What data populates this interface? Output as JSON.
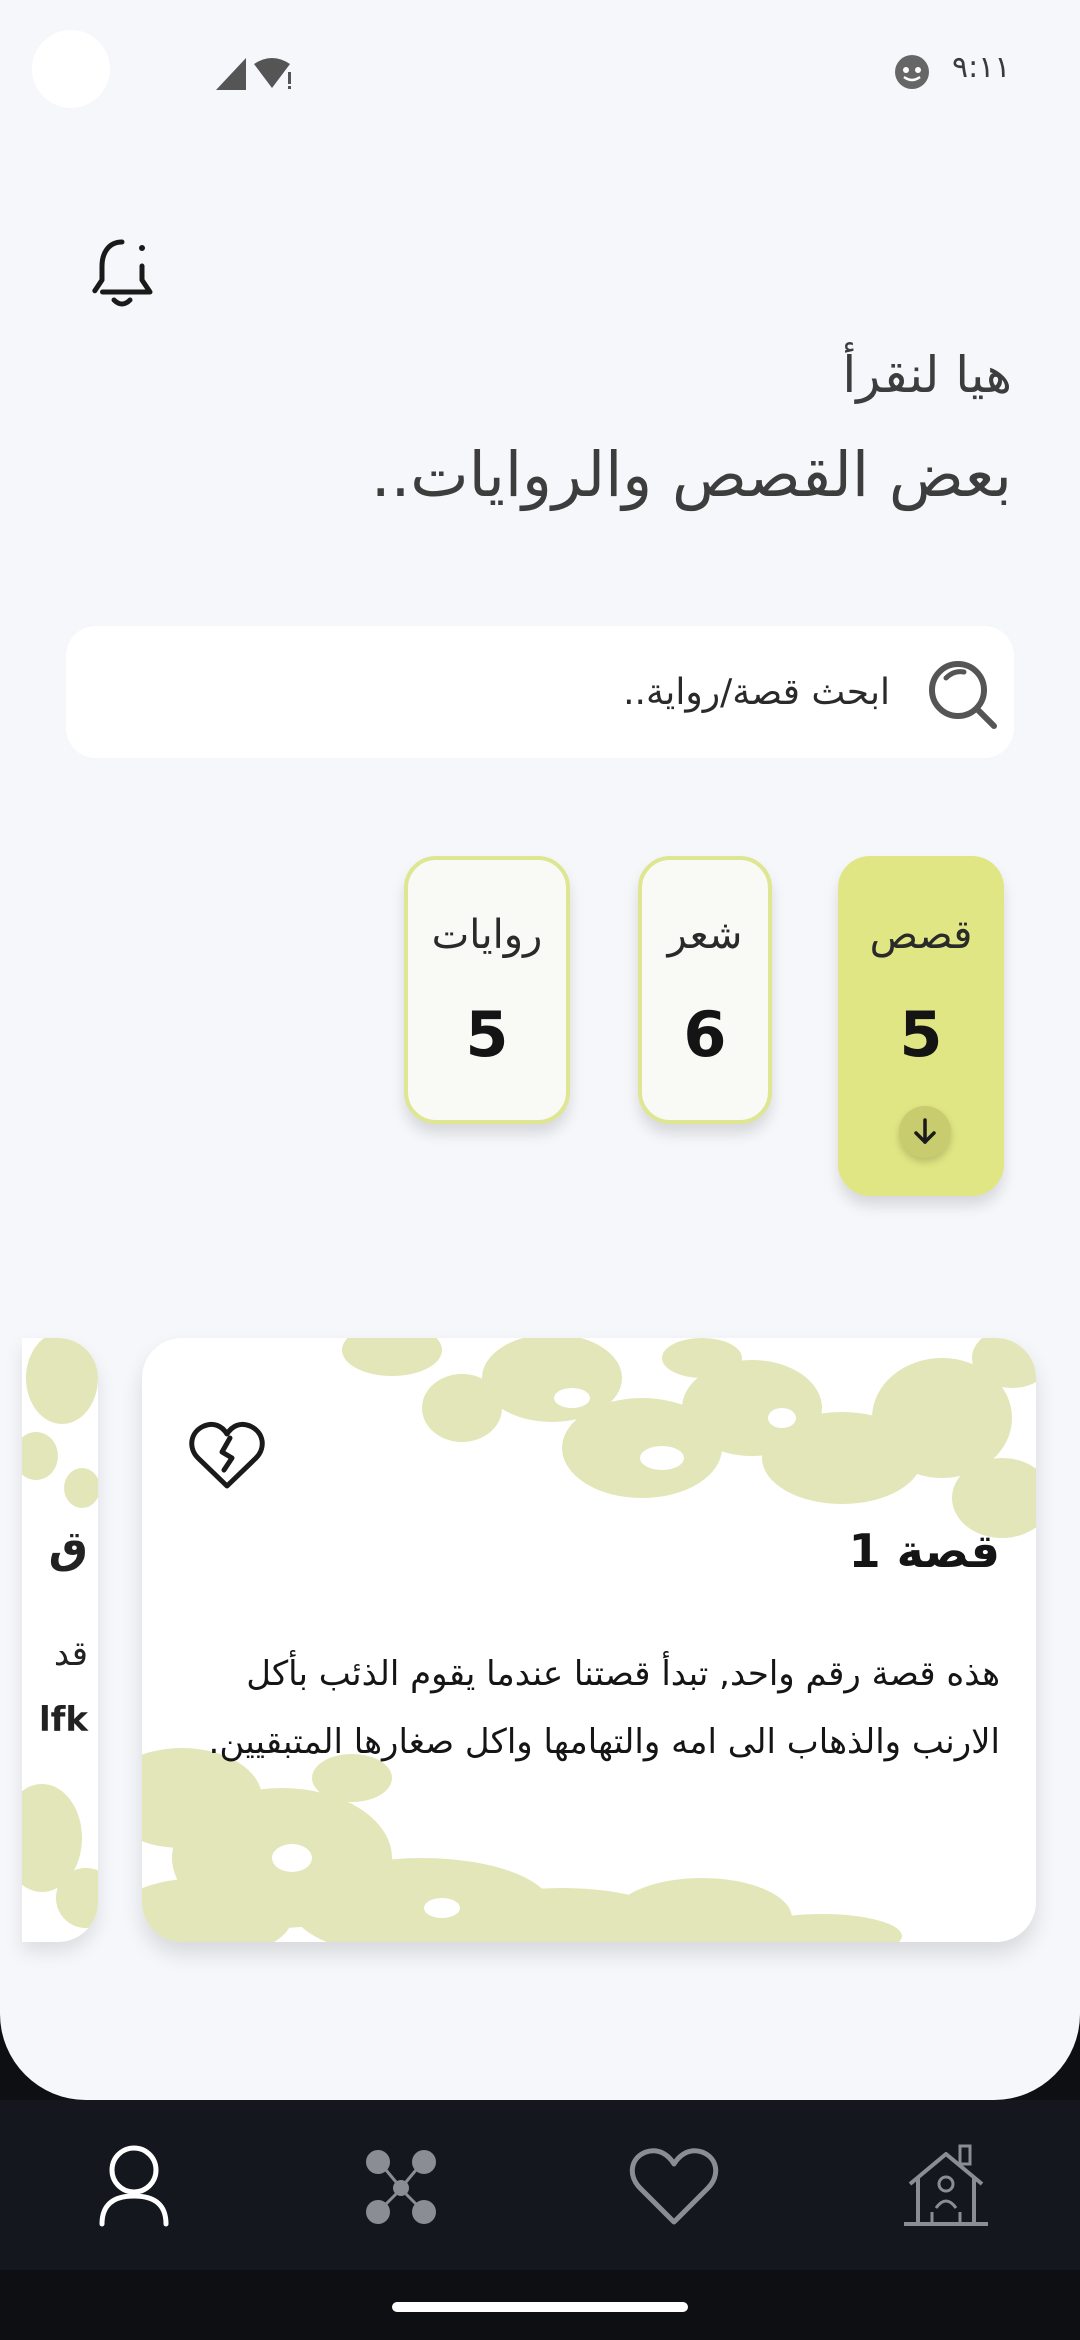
{
  "status_bar": {
    "time": "٩:١١"
  },
  "header": {
    "greeting_line1": "هيا لنقرأ",
    "greeting_line2": "بعض القصص والروايات.."
  },
  "search": {
    "placeholder": "ابحث قصة/رواية.."
  },
  "categories": [
    {
      "label": "قصص",
      "count": "5",
      "active": true
    },
    {
      "label": "شعر",
      "count": "6",
      "active": false
    },
    {
      "label": "روايات",
      "count": "5",
      "active": false
    }
  ],
  "stories": [
    {
      "title": "قصة 1",
      "body": "هذه قصة رقم واحد, تبدأ قصتنا عندما يقوم الذئب بأكل الارنب والذهاب الى امه والتهامها واكل صغارها المتبقيين."
    }
  ],
  "peek_card": {
    "title_fragment": "ق",
    "text_fragment": "قد",
    "text_fragment_2": "lfk"
  },
  "colors": {
    "accent": "#e1e684",
    "card_pattern": "#e3e6b8",
    "nav_bg": "#14171d",
    "screen_bg": "#f6f7fb"
  },
  "icons": {
    "bell": "bell-icon",
    "search": "search-icon",
    "favorite_toggle": "heart-broken-icon",
    "nav": [
      "user-icon",
      "social-network-icon",
      "heart-icon",
      "home-icon"
    ]
  }
}
